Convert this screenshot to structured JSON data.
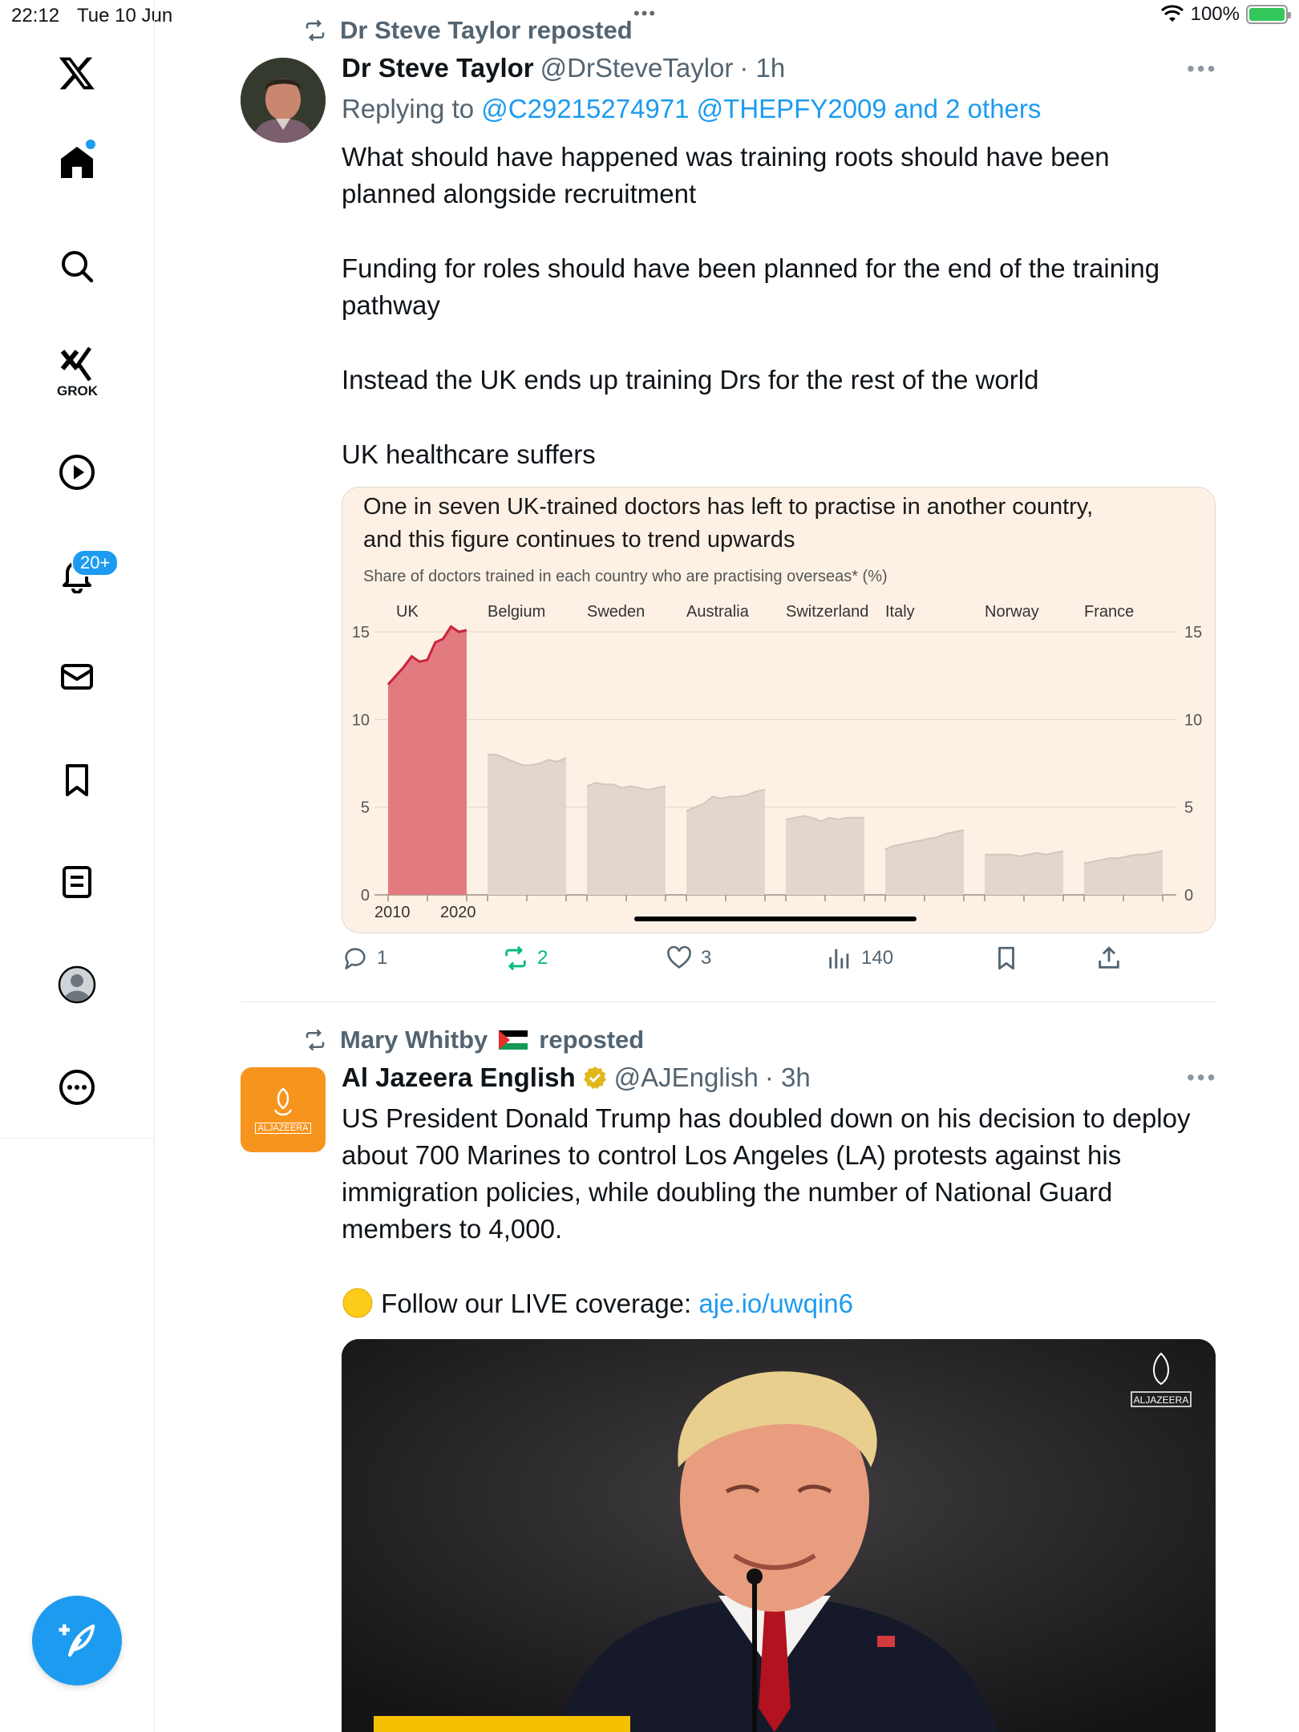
{
  "status": {
    "time": "22:12",
    "date": "Tue 10 Jun",
    "battery": "100%",
    "dots": "•••"
  },
  "sidebar": {
    "grok_label": "GROK",
    "notifications_badge": "20+"
  },
  "tweet1": {
    "repost_label": "Dr Steve Taylor reposted",
    "name": "Dr Steve Taylor",
    "handle": "@DrSteveTaylor",
    "time": "· 1h",
    "replying_prefix": "Replying to",
    "replying_to": "@C29215274971 @THEPFY2009 and 2 others",
    "paragraphs": [
      "What should have happened was training roots should have been planned alongside recruitment",
      "Funding for roles should have been planned for the end of the training pathway",
      "Instead the UK ends up training Drs for the rest of the world",
      "UK healthcare suffers"
    ],
    "stats": {
      "replies": "1",
      "reposts": "2",
      "likes": "3",
      "views": "140"
    }
  },
  "tweet2": {
    "repost_by": "Mary Whitby",
    "repost_suffix": "reposted",
    "name": "Al Jazeera English",
    "handle": "@AJEnglish",
    "time": "· 3h",
    "text": "US President Donald Trump has doubled down on his decision to deploy about 700 Marines to control Los Angeles (LA) protests against his immigration policies, while doubling the number of National Guard members to 4,000.",
    "follow_prefix": "Follow our LIVE coverage:",
    "follow_link": "aje.io/uwqin6",
    "logo_text": "ALJAZEERA",
    "media_logo_text": "ALJAZEERA"
  },
  "colors": {
    "accent": "#1d9bf0",
    "repost_green": "#00ba7c",
    "uk_red": "#d64a59",
    "chart_bg": "#fdf1e5"
  },
  "chart_data": {
    "type": "area",
    "title_line1": "One in seven UK-trained doctors has left to practise in another country,",
    "title_line2": "and this figure continues to trend upwards",
    "subtitle": "Share of doctors trained in each country who are practising overseas* (%)",
    "ylim": [
      0,
      15
    ],
    "yticks": [
      0,
      5,
      10,
      15
    ],
    "x_tick_labels": [
      "2010",
      "2020"
    ],
    "grid": true,
    "panels": [
      {
        "name": "UK",
        "highlight": true,
        "values": [
          12.0,
          12.5,
          13.0,
          13.6,
          13.3,
          13.4,
          14.4,
          14.6,
          15.3,
          15.0,
          15.1
        ]
      },
      {
        "name": "Belgium",
        "values": [
          8.0,
          8.0,
          7.8,
          7.6,
          7.4,
          7.4,
          7.5,
          7.7,
          7.6,
          7.8
        ]
      },
      {
        "name": "Sweden",
        "values": [
          6.2,
          6.4,
          6.3,
          6.3,
          6.1,
          6.2,
          6.1,
          6.0,
          6.1,
          6.2
        ]
      },
      {
        "name": "Australia",
        "values": [
          4.8,
          5.0,
          5.2,
          5.6,
          5.5,
          5.6,
          5.6,
          5.7,
          5.9,
          6.0
        ]
      },
      {
        "name": "Switzerland",
        "values": [
          4.3,
          4.4,
          4.5,
          4.4,
          4.2,
          4.4,
          4.3,
          4.4,
          4.4,
          4.4
        ]
      },
      {
        "name": "Italy",
        "values": [
          2.6,
          2.8,
          2.9,
          3.0,
          3.1,
          3.2,
          3.3,
          3.5,
          3.6,
          3.7
        ]
      },
      {
        "name": "Norway",
        "values": [
          2.3,
          2.3,
          2.3,
          2.3,
          2.2,
          2.3,
          2.4,
          2.3,
          2.4,
          2.5
        ]
      },
      {
        "name": "France",
        "values": [
          1.8,
          1.9,
          2.0,
          2.1,
          2.1,
          2.2,
          2.3,
          2.3,
          2.4,
          2.5
        ]
      }
    ]
  }
}
